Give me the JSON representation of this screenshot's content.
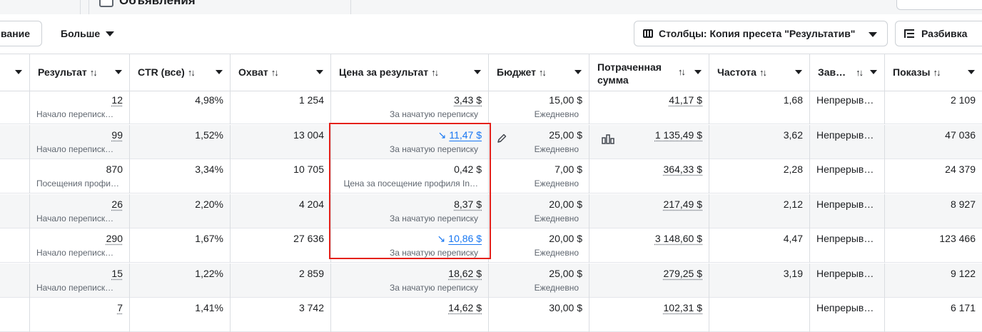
{
  "top": {
    "tab_label": "Объявления"
  },
  "toolbar": {
    "partial_label": "вание",
    "more_label": "Больше",
    "columns_label": "Столбцы: Копия пресета \"Результатив\"",
    "breakdown_label": "Разбивка"
  },
  "columns": {
    "result": "Результат",
    "ctr": "CTR (все)",
    "reach": "Охват",
    "cost": "Цена за результат",
    "budget": "Бюджет",
    "spent": "Потраченная сумма",
    "frequency": "Частота",
    "end": "Зав…",
    "impressions": "Показы",
    "sort_glyph": "↑↓"
  },
  "rows": [
    {
      "result": "12",
      "result_sub": "Начало переписк…",
      "ctr": "4,98%",
      "reach": "1 254",
      "cost": "3,43 $",
      "cost_sub": "За начатую переписку",
      "budget": "15,00 $",
      "budget_sub": "Ежедневно",
      "spent": "41,17 $",
      "frequency": "1,68",
      "end": "Непрерыв…",
      "impressions": "2 109"
    },
    {
      "result": "99",
      "result_sub": "Начало переписк…",
      "ctr": "1,52%",
      "reach": "13 004",
      "cost": "11,47 $",
      "cost_sub": "За начатую переписку",
      "budget": "25,00 $",
      "budget_sub": "Ежедневно",
      "spent": "1 135,49 $",
      "frequency": "3,62",
      "end": "Непрерыв…",
      "impressions": "47 036"
    },
    {
      "result": "870",
      "result_sub": "Посещения профи…",
      "ctr": "3,34%",
      "reach": "10 705",
      "cost": "0,42 $",
      "cost_sub": "Цена за посещение профиля In…",
      "budget": "7,00 $",
      "budget_sub": "Ежедневно",
      "spent": "364,33 $",
      "frequency": "2,28",
      "end": "Непрерыв…",
      "impressions": "24 379"
    },
    {
      "result": "26",
      "result_sub": "Начало переписк…",
      "ctr": "2,20%",
      "reach": "4 204",
      "cost": "8,37 $",
      "cost_sub": "За начатую переписку",
      "budget": "20,00 $",
      "budget_sub": "Ежедневно",
      "spent": "217,49 $",
      "frequency": "2,12",
      "end": "Непрерыв…",
      "impressions": "8 927"
    },
    {
      "result": "290",
      "result_sub": "Начало переписк…",
      "ctr": "1,67%",
      "reach": "27 636",
      "cost": "10,86 $",
      "cost_sub": "За начатую переписку",
      "budget": "20,00 $",
      "budget_sub": "Ежедневно",
      "spent": "3 148,60 $",
      "frequency": "4,47",
      "end": "Непрерыв…",
      "impressions": "123 466"
    },
    {
      "result": "15",
      "result_sub": "Начало переписк…",
      "ctr": "1,22%",
      "reach": "2 859",
      "cost": "18,62 $",
      "cost_sub": "За начатую переписку",
      "budget": "25,00 $",
      "budget_sub": "Ежедневно",
      "spent": "279,25 $",
      "frequency": "3,19",
      "end": "Непрерыв…",
      "impressions": "9 122"
    },
    {
      "result": "7",
      "result_sub": "",
      "ctr": "1,41%",
      "reach": "3 742",
      "cost": "14,62 $",
      "cost_sub": "",
      "budget": "30,00 $",
      "budget_sub": "",
      "spent": "102,31 $",
      "frequency": "",
      "end": "Непрерыв…",
      "impressions": "6 171"
    }
  ],
  "trend_glyph": "↘",
  "colors": {
    "link": "#1877f2",
    "highlight_box": "#e4211b",
    "row_alt": "#f5f6f7"
  }
}
